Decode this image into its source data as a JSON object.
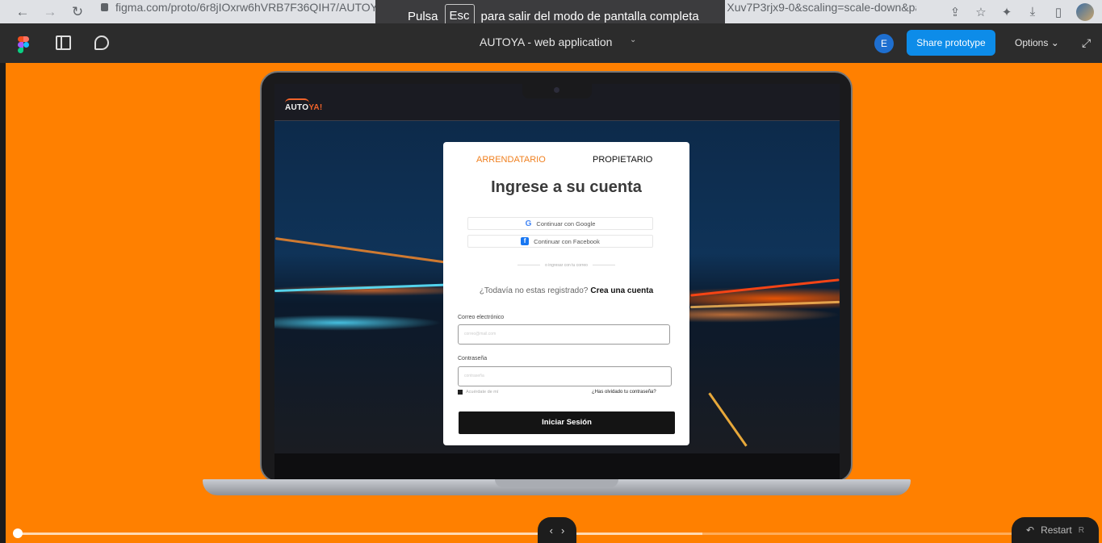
{
  "browser": {
    "url": "figma.com/proto/6r8jIOxrw6hVRB7F36QIH7/AUTOYA---w",
    "url_tail": "Xuv7P3rjx9-0&scaling=scale-down&pag...",
    "fullscreen_toast": {
      "prefix": "Pulsa",
      "key": "Esc",
      "suffix": "para salir del modo de pantalla completa"
    }
  },
  "figma": {
    "document_title": "AUTOYA - web application",
    "avatar_initial": "E",
    "share_label": "Share prototype",
    "options_label": "Options"
  },
  "app": {
    "brand": {
      "main": "AUTO",
      "accent": "YA!"
    },
    "tabs": {
      "tenant": "ARRENDATARIO",
      "owner": "PROPIETARIO"
    },
    "title": "Ingrese a su cuenta",
    "google_label": "Continuar con Google",
    "facebook_label": "Continuar con Facebook",
    "divider_text": "o ingresar con tu correo",
    "register_prompt": "¿Todavía no estas registrado?",
    "register_link": "Crea una cuenta",
    "email_label": "Correo electrónico",
    "email_placeholder": "correo@mail.com",
    "password_label": "Contraseña",
    "password_placeholder": "contraseña",
    "remember_label": "Acuérdate de mí",
    "forgot_label": "¿Has olvidado tu contraseña?",
    "submit_label": "Iniciar Sesión"
  },
  "player": {
    "restart_label": "Restart",
    "restart_key": "R"
  },
  "colors": {
    "canvas": "#ff8000",
    "accent_orange": "#f08020",
    "share_blue": "#0d8ce9"
  }
}
